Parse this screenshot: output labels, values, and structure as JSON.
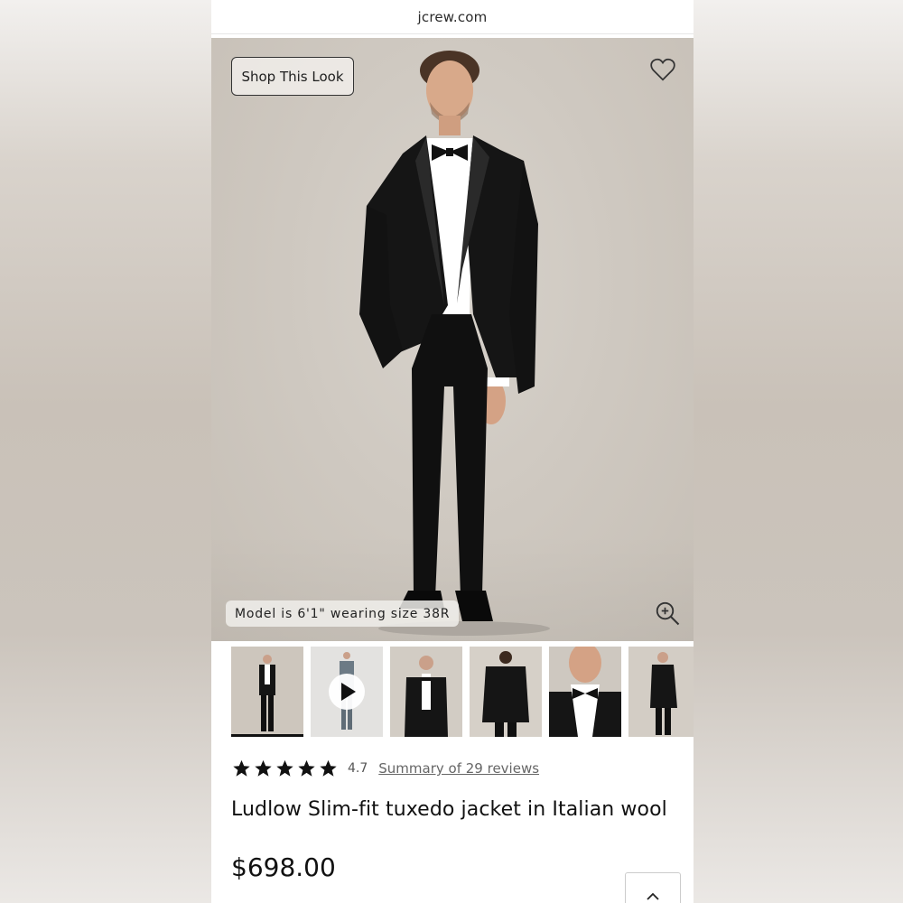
{
  "browser": {
    "url": "jcrew.com"
  },
  "hero": {
    "shop_look_label": "Shop This Look",
    "model_info": "Model is 6'1\" wearing size 38R",
    "icons": [
      "heart-icon",
      "zoom-in-icon"
    ]
  },
  "thumbnails": [
    {
      "name": "full-body-front",
      "active": true
    },
    {
      "name": "video",
      "active": false
    },
    {
      "name": "upper-body-front",
      "active": false
    },
    {
      "name": "back-view",
      "active": false
    },
    {
      "name": "collar-detail",
      "active": false
    },
    {
      "name": "side-view",
      "active": false
    }
  ],
  "product": {
    "rating": 4.7,
    "rating_text": "4.7",
    "stars": 5,
    "reviews_link": "Summary of 29 reviews",
    "title": "Ludlow Slim-fit tuxedo jacket in Italian wool",
    "price": "$698.00"
  },
  "colors": {
    "text": "#111111",
    "muted": "#666666",
    "suit": "#121212",
    "backdrop": "#cfc9c1"
  }
}
